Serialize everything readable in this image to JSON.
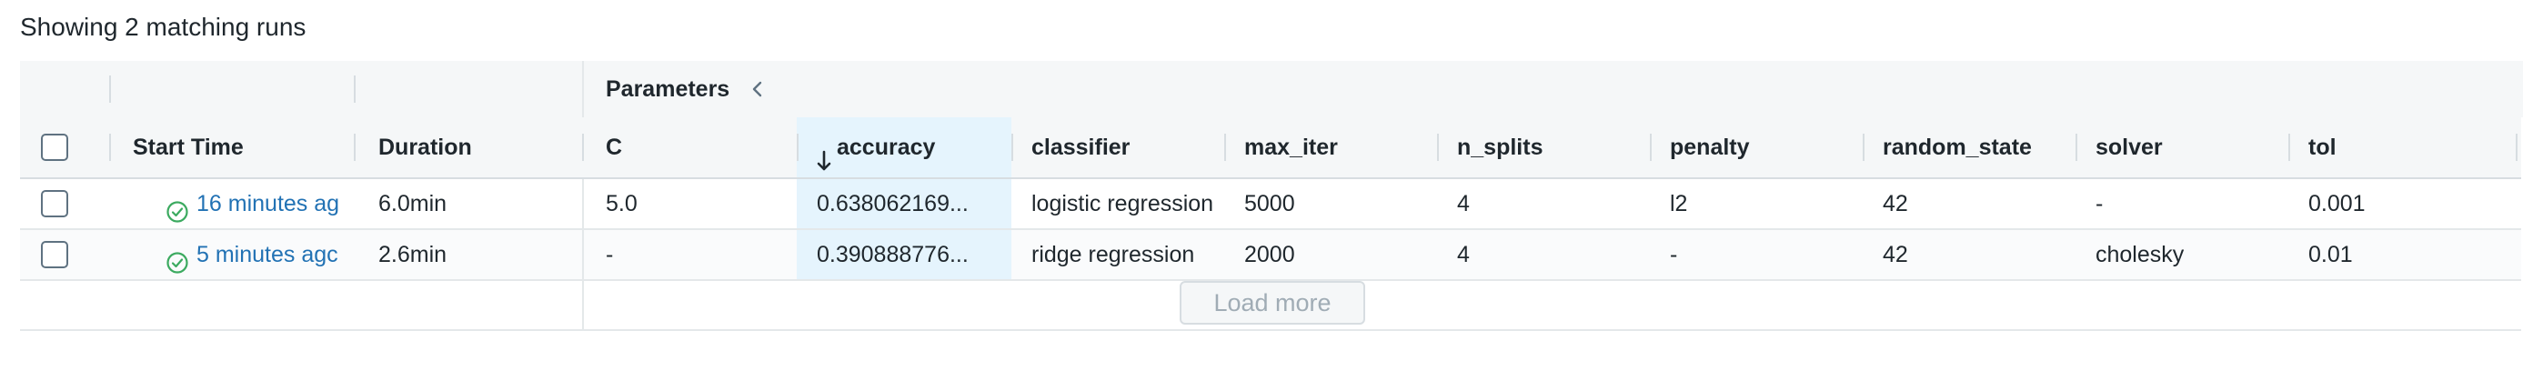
{
  "summary": "Showing 2 matching runs",
  "group_header": {
    "label": "Parameters"
  },
  "columns": {
    "start_time": "Start Time",
    "duration": "Duration",
    "c": "C",
    "accuracy": "accuracy",
    "accuracy_sort_icon": "arrow-down-icon",
    "classifier": "classifier",
    "max_iter": "max_iter",
    "n_splits": "n_splits",
    "penalty": "penalty",
    "random_state": "random_state",
    "solver": "solver",
    "tol": "tol"
  },
  "rows": [
    {
      "start_time": "16 minutes ag",
      "status_icon": "success-check-icon",
      "duration": "6.0min",
      "c": "5.0",
      "accuracy": "0.638062169...",
      "classifier": "logistic regression",
      "max_iter": "5000",
      "n_splits": "4",
      "penalty": "l2",
      "random_state": "42",
      "solver": "-",
      "tol": "0.001"
    },
    {
      "start_time": "5 minutes agc",
      "status_icon": "success-check-icon",
      "duration": "2.6min",
      "c": "-",
      "accuracy": "0.390888776...",
      "classifier": "ridge regression",
      "max_iter": "2000",
      "n_splits": "4",
      "penalty": "-",
      "random_state": "42",
      "solver": "cholesky",
      "tol": "0.01"
    }
  ],
  "load_more_label": "Load more",
  "colors": {
    "link": "#2272b4",
    "success": "#3caa60",
    "sorted_column_bg": "#e5f4fd",
    "header_bg": "#f5f7f8"
  }
}
